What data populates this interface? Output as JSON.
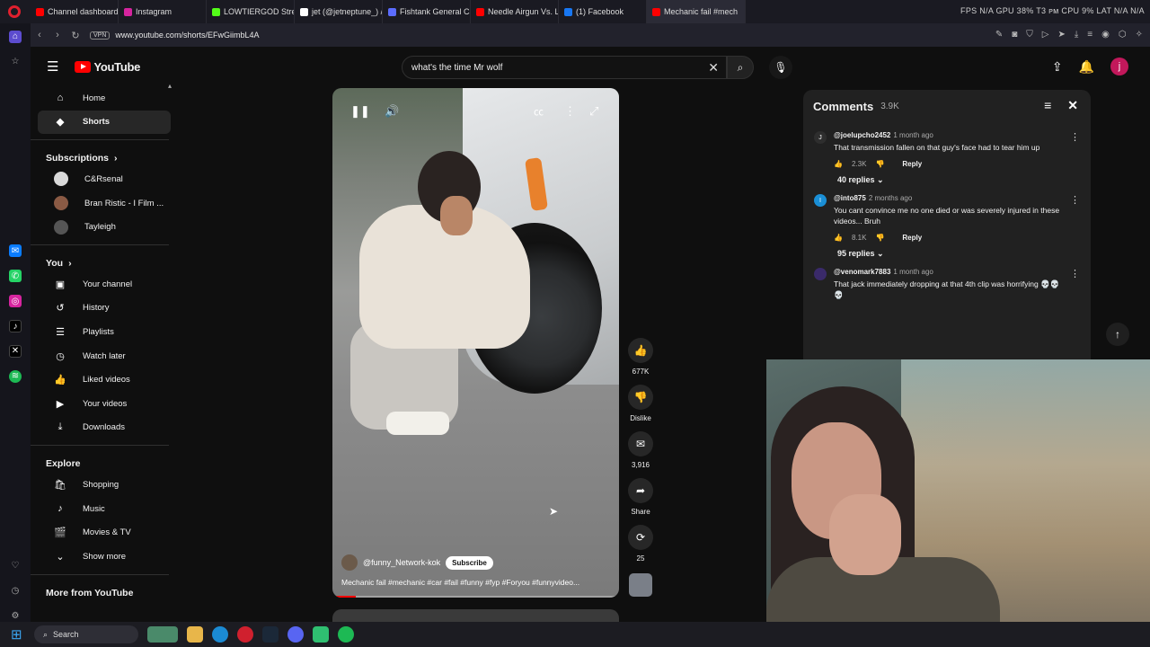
{
  "browser": {
    "tabs": [
      {
        "label": "Channel dashboard",
        "color": "#ff0000"
      },
      {
        "label": "Instagram",
        "color": "#d6249f"
      },
      {
        "label": "LOWTIERGOD Stream",
        "color": "#53fc18"
      },
      {
        "label": "jet (@jetneptune_) / X",
        "color": "#ffffff"
      },
      {
        "label": "Fishtank General Ca",
        "color": "#5b6cff"
      },
      {
        "label": "Needle Airgun Vs. Le",
        "color": "#ff0000"
      },
      {
        "label": "(1) Facebook",
        "color": "#1877f2"
      },
      {
        "label": "Mechanic fail #mech",
        "color": "#ff0000"
      }
    ],
    "sysinfo": "FPS N/A  GPU 38%  T3 ᴘᴍ  CPU 9%  LAT N/A  N/A",
    "vpn_label": "VPN",
    "url": "www.youtube.com/shorts/EFwGiimbL4A"
  },
  "youtube": {
    "logo_text": "YouTube",
    "search": {
      "value": "what's the time Mr wolf"
    },
    "user_initial": "j",
    "sidebar": {
      "main": [
        {
          "label": "Home",
          "icon": "home-icon",
          "glyph": "⌂"
        },
        {
          "label": "Shorts",
          "icon": "shorts-icon",
          "glyph": "◆"
        }
      ],
      "subscriptions_title": "Subscriptions",
      "subscriptions": [
        {
          "label": "C&Rsenal",
          "color": "#d9d9d9"
        },
        {
          "label": "Bran Ristic - I Film ...",
          "color": "#8a5a44"
        },
        {
          "label": "Tayleigh",
          "color": "#555555"
        }
      ],
      "you_title": "You",
      "you": [
        {
          "label": "Your channel",
          "icon": "your-channel-icon",
          "glyph": "▣"
        },
        {
          "label": "History",
          "icon": "history-icon",
          "glyph": "↺"
        },
        {
          "label": "Playlists",
          "icon": "playlists-icon",
          "glyph": "☰"
        },
        {
          "label": "Watch later",
          "icon": "watch-later-icon",
          "glyph": "◷"
        },
        {
          "label": "Liked videos",
          "icon": "like-icon",
          "glyph": "👍"
        },
        {
          "label": "Your videos",
          "icon": "your-videos-icon",
          "glyph": "▶"
        },
        {
          "label": "Downloads",
          "icon": "download-icon",
          "glyph": "⤓"
        }
      ],
      "explore_title": "Explore",
      "explore": [
        {
          "label": "Shopping",
          "icon": "shopping-icon",
          "glyph": "🛍"
        },
        {
          "label": "Music",
          "icon": "music-icon",
          "glyph": "♪"
        },
        {
          "label": "Movies & TV",
          "icon": "movies-icon",
          "glyph": "🎬"
        },
        {
          "label": "Show more",
          "icon": "chevron-down-icon",
          "glyph": "⌄"
        }
      ],
      "more_title": "More from YouTube"
    },
    "short": {
      "channel": "@funny_Network-kok",
      "subscribe_label": "Subscribe",
      "caption": "Mechanic fail #mechanic #car #fail #funny #fyp #Foryou #funnyvideo...",
      "progress": 0.08
    },
    "actions": {
      "likes": "677K",
      "dislike_label": "Dislike",
      "comments": "3,916",
      "share_label": "Share",
      "remix": "25"
    },
    "comments_panel": {
      "title": "Comments",
      "count": "3.9K",
      "comments": [
        {
          "handle": "@joelupcho2452",
          "time": "1 month ago",
          "text": "That transmission fallen on that guy's face had to tear him up",
          "likes": "2.3K",
          "reply_label": "Reply",
          "replies": "40 replies",
          "avatar_letter": "J",
          "avatar_color": "#2e2e2e"
        },
        {
          "handle": "@into875",
          "time": "2 months ago",
          "text": "You cant convince me no one died or was severely injured in these videos... Bruh",
          "likes": "8.1K",
          "reply_label": "Reply",
          "replies": "95 replies",
          "avatar_letter": "I",
          "avatar_color": "#1a8fd6"
        },
        {
          "handle": "@venomark7883",
          "time": "1 month ago",
          "text": "That jack immediately dropping at that 4th clip was horrifying 💀💀💀",
          "likes": "",
          "reply_label": "",
          "replies": "",
          "avatar_letter": "",
          "avatar_color": "#3a2a6a"
        }
      ]
    }
  },
  "taskbar": {
    "search_label": "Search"
  }
}
